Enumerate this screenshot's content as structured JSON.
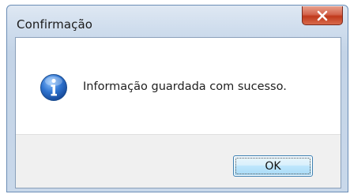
{
  "dialog": {
    "title": "Confirmação",
    "message": "Informação guardada com sucesso.",
    "ok_label": "OK",
    "icon": "info-icon",
    "close_icon": "close-icon"
  },
  "colors": {
    "close_button": "#c8452a",
    "ok_border": "#3c7fb1",
    "info_icon": "#1f5fb5"
  }
}
